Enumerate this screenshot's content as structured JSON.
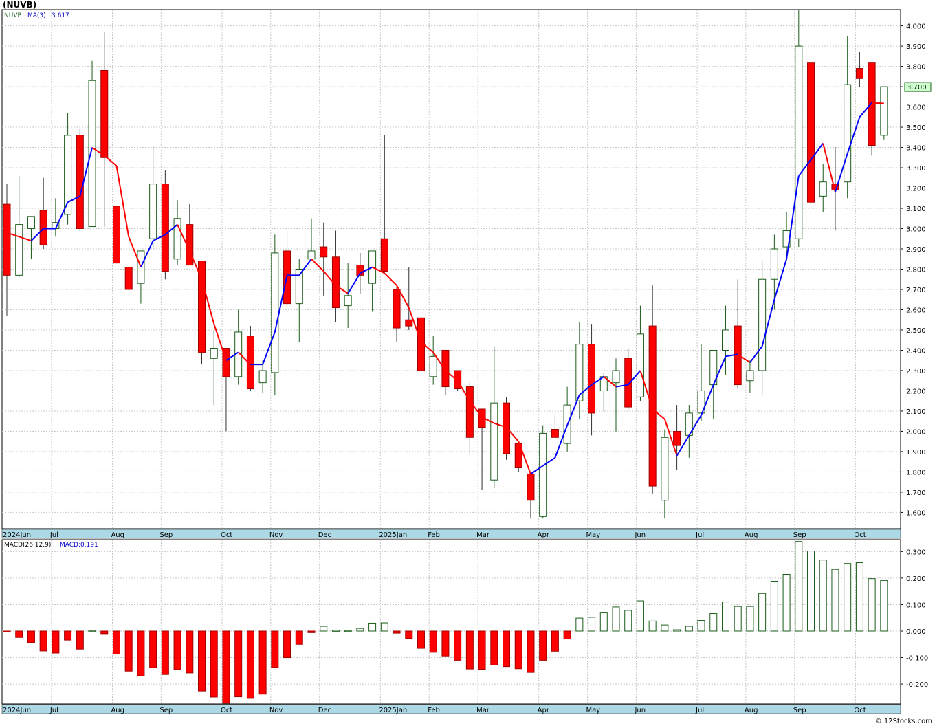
{
  "title": "(NUVB)",
  "credit": "© 12Stocks.com",
  "chart_data": [
    {
      "type": "candlestick",
      "title": "(NUVB)",
      "legend": {
        "symbol": "NUVB",
        "ma_label": "MA(3)",
        "ma_value": "3.617"
      },
      "last_price_label": "3.700",
      "ylim": [
        1.52,
        4.08
      ],
      "y_ticks": [
        "1.600",
        "1.700",
        "1.800",
        "1.900",
        "2.000",
        "2.100",
        "2.200",
        "2.300",
        "2.400",
        "2.500",
        "2.600",
        "2.700",
        "2.800",
        "2.900",
        "3.000",
        "3.100",
        "3.200",
        "3.300",
        "3.400",
        "3.500",
        "3.600",
        "3.700",
        "3.800",
        "3.900",
        "4.000"
      ],
      "x_month_labels": [
        {
          "label": "2024Jun",
          "week": 0
        },
        {
          "label": "Jul",
          "week": 4
        },
        {
          "label": "Aug",
          "week": 9
        },
        {
          "label": "Sep",
          "week": 13
        },
        {
          "label": "Oct",
          "week": 18
        },
        {
          "label": "Nov",
          "week": 22
        },
        {
          "label": "Dec",
          "week": 26
        },
        {
          "label": "2025Jan",
          "week": 31
        },
        {
          "label": "Feb",
          "week": 35
        },
        {
          "label": "Mar",
          "week": 39
        },
        {
          "label": "Apr",
          "week": 44
        },
        {
          "label": "May",
          "week": 48
        },
        {
          "label": "Jun",
          "week": 52
        },
        {
          "label": "Jul",
          "week": 57
        },
        {
          "label": "Aug",
          "week": 61
        },
        {
          "label": "Sep",
          "week": 65
        },
        {
          "label": "Oct",
          "week": 70
        }
      ],
      "candles": [
        {
          "o": 3.12,
          "h": 3.22,
          "l": 2.57,
          "c": 2.77
        },
        {
          "o": 2.77,
          "h": 3.26,
          "l": 2.76,
          "c": 3.02
        },
        {
          "o": 3.0,
          "h": 3.06,
          "l": 2.85,
          "c": 3.06
        },
        {
          "o": 3.09,
          "h": 3.25,
          "l": 2.9,
          "c": 2.92
        },
        {
          "o": 3.0,
          "h": 3.15,
          "l": 2.96,
          "c": 3.03
        },
        {
          "o": 3.07,
          "h": 3.57,
          "l": 3.02,
          "c": 3.46
        },
        {
          "o": 3.46,
          "h": 3.49,
          "l": 2.99,
          "c": 3.0
        },
        {
          "o": 3.01,
          "h": 3.83,
          "l": 3.01,
          "c": 3.73
        },
        {
          "o": 3.78,
          "h": 3.97,
          "l": 3.01,
          "c": 3.35
        },
        {
          "o": 3.11,
          "h": 3.11,
          "l": 2.83,
          "c": 2.83
        },
        {
          "o": 2.81,
          "h": 2.81,
          "l": 2.7,
          "c": 2.7
        },
        {
          "o": 2.73,
          "h": 2.89,
          "l": 2.63,
          "c": 2.89
        },
        {
          "o": 2.95,
          "h": 3.4,
          "l": 2.9,
          "c": 3.22
        },
        {
          "o": 3.22,
          "h": 3.29,
          "l": 2.75,
          "c": 2.79
        },
        {
          "o": 2.85,
          "h": 3.14,
          "l": 2.82,
          "c": 3.05
        },
        {
          "o": 3.02,
          "h": 3.12,
          "l": 2.83,
          "c": 2.82
        },
        {
          "o": 2.84,
          "h": 2.84,
          "l": 2.33,
          "c": 2.39
        },
        {
          "o": 2.36,
          "h": 2.5,
          "l": 2.13,
          "c": 2.41
        },
        {
          "o": 2.41,
          "h": 2.41,
          "l": 2.0,
          "c": 2.27
        },
        {
          "o": 2.27,
          "h": 2.6,
          "l": 2.23,
          "c": 2.49
        },
        {
          "o": 2.47,
          "h": 2.52,
          "l": 2.2,
          "c": 2.21
        },
        {
          "o": 2.24,
          "h": 2.35,
          "l": 2.19,
          "c": 2.3
        },
        {
          "o": 2.29,
          "h": 2.97,
          "l": 2.18,
          "c": 2.88
        },
        {
          "o": 2.89,
          "h": 2.99,
          "l": 2.6,
          "c": 2.63
        },
        {
          "o": 2.63,
          "h": 2.85,
          "l": 2.44,
          "c": 2.8
        },
        {
          "o": 2.85,
          "h": 3.05,
          "l": 2.85,
          "c": 2.89
        },
        {
          "o": 2.91,
          "h": 3.03,
          "l": 2.67,
          "c": 2.86
        },
        {
          "o": 2.86,
          "h": 2.99,
          "l": 2.54,
          "c": 2.61
        },
        {
          "o": 2.62,
          "h": 2.83,
          "l": 2.51,
          "c": 2.67
        },
        {
          "o": 2.82,
          "h": 2.88,
          "l": 2.68,
          "c": 2.77
        },
        {
          "o": 2.73,
          "h": 2.89,
          "l": 2.59,
          "c": 2.89
        },
        {
          "o": 2.95,
          "h": 3.46,
          "l": 2.78,
          "c": 2.79
        },
        {
          "o": 2.7,
          "h": 2.71,
          "l": 2.44,
          "c": 2.51
        },
        {
          "o": 2.55,
          "h": 2.81,
          "l": 2.5,
          "c": 2.52
        },
        {
          "o": 2.56,
          "h": 2.56,
          "l": 2.28,
          "c": 2.3
        },
        {
          "o": 2.27,
          "h": 2.47,
          "l": 2.23,
          "c": 2.37
        },
        {
          "o": 2.4,
          "h": 2.4,
          "l": 2.18,
          "c": 2.22
        },
        {
          "o": 2.3,
          "h": 2.3,
          "l": 2.2,
          "c": 2.21
        },
        {
          "o": 2.22,
          "h": 2.24,
          "l": 1.89,
          "c": 1.97
        },
        {
          "o": 2.11,
          "h": 2.11,
          "l": 1.71,
          "c": 2.02
        },
        {
          "o": 1.76,
          "h": 2.42,
          "l": 1.72,
          "c": 2.14
        },
        {
          "o": 2.14,
          "h": 2.17,
          "l": 1.86,
          "c": 1.89
        },
        {
          "o": 1.94,
          "h": 1.95,
          "l": 1.8,
          "c": 1.82
        },
        {
          "o": 1.79,
          "h": 1.8,
          "l": 1.57,
          "c": 1.66
        },
        {
          "o": 1.58,
          "h": 2.03,
          "l": 1.57,
          "c": 1.99
        },
        {
          "o": 2.01,
          "h": 2.08,
          "l": 1.97,
          "c": 1.97
        },
        {
          "o": 1.94,
          "h": 2.22,
          "l": 1.9,
          "c": 2.13
        },
        {
          "o": 2.15,
          "h": 2.54,
          "l": 2.06,
          "c": 2.43
        },
        {
          "o": 2.43,
          "h": 2.53,
          "l": 1.98,
          "c": 2.09
        },
        {
          "o": 2.2,
          "h": 2.29,
          "l": 2.1,
          "c": 2.27
        },
        {
          "o": 2.24,
          "h": 2.36,
          "l": 2.0,
          "c": 2.3
        },
        {
          "o": 2.36,
          "h": 2.41,
          "l": 2.11,
          "c": 2.12
        },
        {
          "o": 2.17,
          "h": 2.62,
          "l": 2.15,
          "c": 2.48
        },
        {
          "o": 2.52,
          "h": 2.72,
          "l": 1.69,
          "c": 1.73
        },
        {
          "o": 1.66,
          "h": 2.01,
          "l": 1.57,
          "c": 1.97
        },
        {
          "o": 2.0,
          "h": 2.13,
          "l": 1.81,
          "c": 1.93
        },
        {
          "o": 1.98,
          "h": 2.13,
          "l": 1.87,
          "c": 2.09
        },
        {
          "o": 2.09,
          "h": 2.43,
          "l": 2.05,
          "c": 2.2
        },
        {
          "o": 2.23,
          "h": 2.39,
          "l": 2.06,
          "c": 2.4
        },
        {
          "o": 2.4,
          "h": 2.62,
          "l": 2.28,
          "c": 2.5
        },
        {
          "o": 2.52,
          "h": 2.75,
          "l": 2.21,
          "c": 2.23
        },
        {
          "o": 2.25,
          "h": 2.35,
          "l": 2.19,
          "c": 2.3
        },
        {
          "o": 2.3,
          "h": 2.84,
          "l": 2.18,
          "c": 2.75
        },
        {
          "o": 2.75,
          "h": 2.97,
          "l": 2.6,
          "c": 2.9
        },
        {
          "o": 2.91,
          "h": 3.08,
          "l": 2.85,
          "c": 2.99
        },
        {
          "o": 2.95,
          "h": 4.08,
          "l": 2.91,
          "c": 3.9
        },
        {
          "o": 3.82,
          "h": 3.82,
          "l": 3.08,
          "c": 3.13
        },
        {
          "o": 3.16,
          "h": 3.32,
          "l": 3.08,
          "c": 3.23
        },
        {
          "o": 3.22,
          "h": 3.4,
          "l": 2.99,
          "c": 3.19
        },
        {
          "o": 3.23,
          "h": 3.95,
          "l": 3.15,
          "c": 3.71
        },
        {
          "o": 3.79,
          "h": 3.87,
          "l": 3.7,
          "c": 3.74
        },
        {
          "o": 3.82,
          "h": 3.82,
          "l": 3.36,
          "c": 3.41
        },
        {
          "o": 3.46,
          "h": 3.7,
          "l": 3.44,
          "c": 3.7
        }
      ],
      "ma": [
        2.98,
        2.96,
        2.94,
        3.0,
        3.0,
        3.13,
        3.16,
        3.4,
        3.36,
        3.31,
        2.96,
        2.81,
        2.94,
        2.97,
        3.02,
        2.89,
        2.75,
        2.53,
        2.35,
        2.39,
        2.33,
        2.33,
        2.49,
        2.77,
        2.77,
        2.85,
        2.79,
        2.72,
        2.68,
        2.78,
        2.81,
        2.78,
        2.72,
        2.61,
        2.44,
        2.39,
        2.3,
        2.25,
        2.15,
        2.07,
        2.04,
        2.02,
        1.95,
        1.79,
        1.83,
        1.87,
        2.03,
        2.18,
        2.23,
        2.27,
        2.22,
        2.23,
        2.3,
        2.11,
        2.06,
        1.88,
        1.98,
        2.08,
        2.23,
        2.37,
        2.38,
        2.34,
        2.42,
        2.65,
        2.85,
        3.26,
        3.34,
        3.42,
        3.18,
        3.37,
        3.55,
        3.62,
        3.617
      ]
    },
    {
      "type": "bar",
      "title": "",
      "legend": {
        "label": "MACD(26,12,9)",
        "value_label": "MACD:0.191"
      },
      "ylim": [
        -0.275,
        0.345
      ],
      "y_ticks": [
        "-0.200",
        "-0.100",
        "0.000",
        "0.100",
        "0.200",
        "0.300"
      ],
      "y_tick_values": [
        -0.2,
        -0.1,
        0.0,
        0.1,
        0.2,
        0.3
      ],
      "values": [
        -0.003,
        -0.024,
        -0.043,
        -0.075,
        -0.083,
        -0.034,
        -0.068,
        0.002,
        -0.01,
        -0.087,
        -0.151,
        -0.169,
        -0.138,
        -0.164,
        -0.145,
        -0.158,
        -0.226,
        -0.249,
        -0.272,
        -0.248,
        -0.254,
        -0.238,
        -0.137,
        -0.1,
        -0.05,
        -0.006,
        0.018,
        0.003,
        0.002,
        0.01,
        0.03,
        0.031,
        -0.008,
        -0.028,
        -0.065,
        -0.08,
        -0.094,
        -0.11,
        -0.143,
        -0.144,
        -0.128,
        -0.134,
        -0.142,
        -0.156,
        -0.11,
        -0.076,
        -0.03,
        0.049,
        0.052,
        0.071,
        0.091,
        0.078,
        0.114,
        0.038,
        0.023,
        0.005,
        0.018,
        0.04,
        0.066,
        0.11,
        0.093,
        0.093,
        0.142,
        0.188,
        0.214,
        0.338,
        0.302,
        0.268,
        0.233,
        0.255,
        0.258,
        0.198,
        0.191
      ]
    }
  ],
  "colors": {
    "up_stroke": "#1a5c1a",
    "down_fill": "#ff0000",
    "ma_up": "#0000ff",
    "ma_down": "#ff0000",
    "axis_band": "#add8e6",
    "grid": "#c8c8c8"
  }
}
